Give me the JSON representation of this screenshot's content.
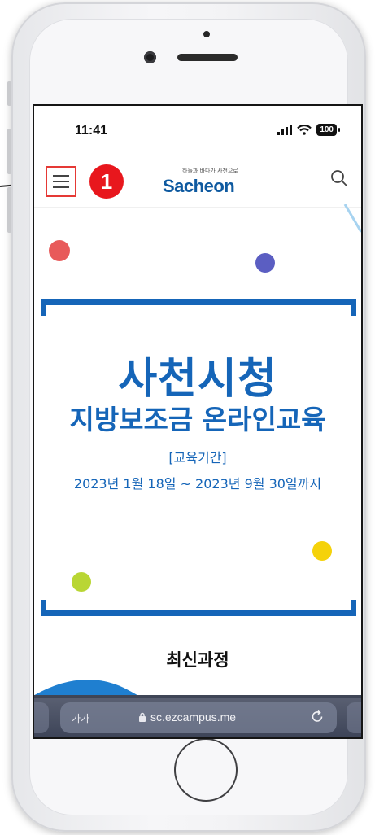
{
  "status_bar": {
    "time": "11:41",
    "battery": "100"
  },
  "nav": {
    "callout_number": "1",
    "logo_tagline": "하늘과 바다가 사천으로",
    "logo_text": "Sacheon"
  },
  "banner": {
    "title": "사천시청",
    "subtitle": "지방보조금 온라인교육",
    "period_label": "[교육기간]",
    "period": "2023년 1월 18일 ~ 2023년 9월 30일까지"
  },
  "section": {
    "title": "최신과정"
  },
  "browser_bar": {
    "text_size": "가가",
    "url": "sc.ezcampus.me"
  },
  "colors": {
    "brand_blue": "#1565b8",
    "callout_red": "#e8171d",
    "dot_red": "#e85a5a",
    "dot_purple": "#5b5ec2",
    "dot_yellow": "#f5d20a",
    "dot_lime": "#b9d634"
  },
  "icons": [
    "hamburger-menu-icon",
    "search-icon",
    "lock-icon",
    "reload-icon",
    "signal-icon",
    "wifi-icon",
    "battery-icon"
  ]
}
